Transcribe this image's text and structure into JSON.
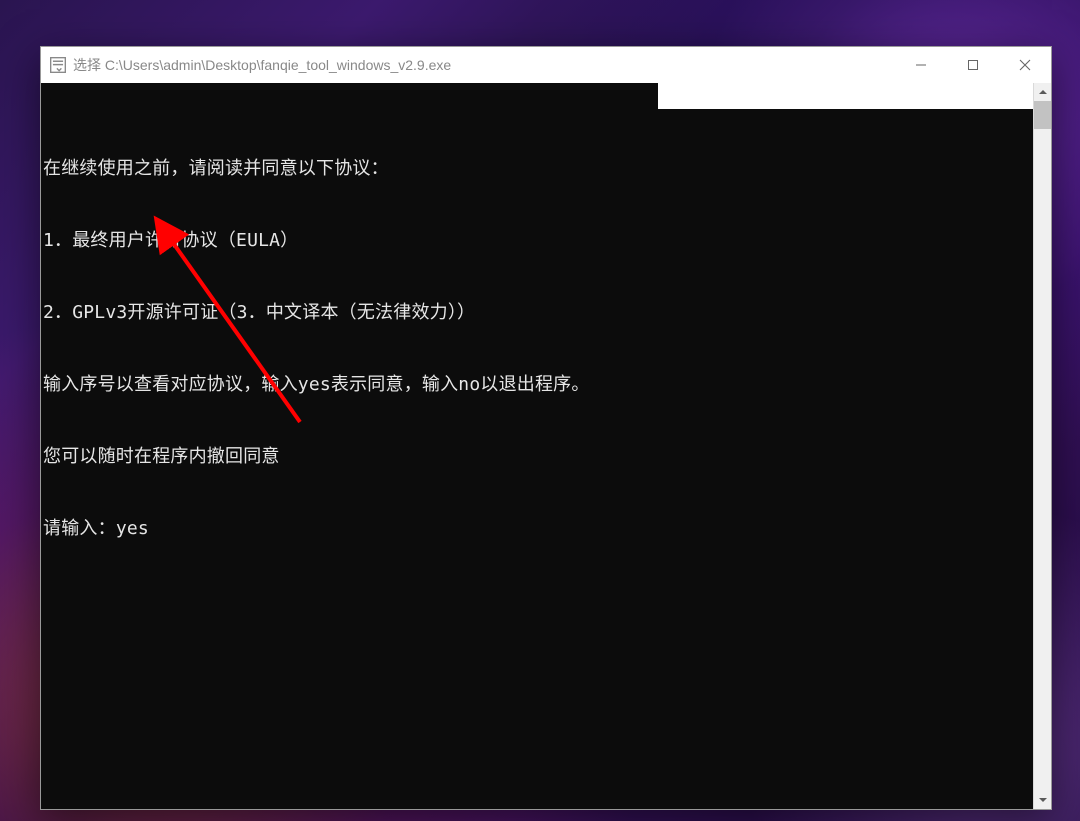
{
  "window": {
    "title": "选择 C:\\Users\\admin\\Desktop\\fanqie_tool_windows_v2.9.exe"
  },
  "console": {
    "lines": [
      "在继续使用之前，请阅读并同意以下协议：",
      "1．最终用户许可协议（EULA）",
      "2．GPLv3开源许可证（3．中文译本（无法律效力））",
      "输入序号以查看对应协议，输入yes表示同意，输入no以退出程序。",
      "您可以随时在程序内撤回同意"
    ],
    "prompt_label": "请输入：",
    "input_value": "yes"
  },
  "annotation": {
    "type": "arrow",
    "color": "#ff0000"
  }
}
